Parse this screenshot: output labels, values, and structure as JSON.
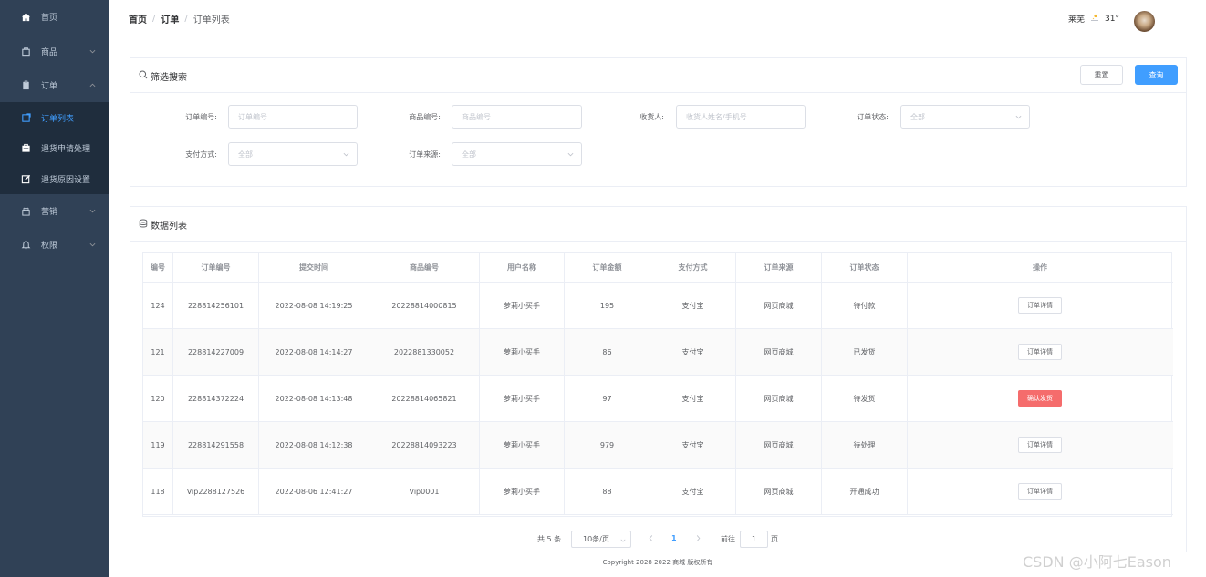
{
  "sidebar": {
    "items": [
      {
        "label": "首页",
        "icon": "home-icon"
      },
      {
        "label": "商品",
        "icon": "bag-icon"
      },
      {
        "label": "订单",
        "icon": "clipboard-icon"
      },
      {
        "label": "营销",
        "icon": "gift-icon"
      },
      {
        "label": "权限",
        "icon": "bell-icon"
      }
    ],
    "order_sub": [
      {
        "label": "订单列表",
        "icon": "list-icon"
      },
      {
        "label": "退货申请处理",
        "icon": "return-icon"
      },
      {
        "label": "退货原因设置",
        "icon": "edit-icon"
      }
    ]
  },
  "header": {
    "breadcrumb": [
      "首页",
      "订单",
      "订单列表"
    ],
    "breadcrumb_sep": "/",
    "city": "莱芜",
    "temperature": "31°"
  },
  "filter": {
    "title": "筛选搜索",
    "reset_label": "重置",
    "query_label": "查询",
    "order_no_label": "订单编号:",
    "order_no_placeholder": "订单编号",
    "product_no_label": "商品编号:",
    "product_no_placeholder": "商品编号",
    "receiver_label": "收货人:",
    "receiver_placeholder": "收货人姓名/手机号",
    "status_label": "订单状态:",
    "status_value": "全部",
    "pay_label": "支付方式:",
    "pay_value": "全部",
    "source_label": "订单来源:",
    "source_value": "全部"
  },
  "table": {
    "title": "数据列表",
    "columns": [
      "编号",
      "订单编号",
      "提交时间",
      "商品编号",
      "用户名称",
      "订单金额",
      "支付方式",
      "订单来源",
      "订单状态",
      "操作"
    ],
    "rows": [
      {
        "id": "124",
        "order_no": "228814256101",
        "time": "2022-08-08 14:19:25",
        "product_no": "20228814000815",
        "user": "萝莉小买手",
        "amount": "195",
        "pay": "支付宝",
        "source": "网页商城",
        "status": "待付款",
        "action": "订单详情",
        "danger": false
      },
      {
        "id": "121",
        "order_no": "228814227009",
        "time": "2022-08-08 14:14:27",
        "product_no": "2022881330052",
        "user": "萝莉小买手",
        "amount": "86",
        "pay": "支付宝",
        "source": "网页商城",
        "status": "已发货",
        "action": "订单详情",
        "danger": false
      },
      {
        "id": "120",
        "order_no": "228814372224",
        "time": "2022-08-08 14:13:48",
        "product_no": "20228814065821",
        "user": "萝莉小买手",
        "amount": "97",
        "pay": "支付宝",
        "source": "网页商城",
        "status": "待发货",
        "action": "确认发货",
        "danger": true
      },
      {
        "id": "119",
        "order_no": "228814291558",
        "time": "2022-08-08 14:12:38",
        "product_no": "20228814093223",
        "user": "萝莉小买手",
        "amount": "979",
        "pay": "支付宝",
        "source": "网页商城",
        "status": "待处理",
        "action": "订单详情",
        "danger": false
      },
      {
        "id": "118",
        "order_no": "Vip2288127526",
        "time": "2022-08-06 12:41:27",
        "product_no": "Vip0001",
        "user": "萝莉小买手",
        "amount": "88",
        "pay": "支付宝",
        "source": "网页商城",
        "status": "开通成功",
        "action": "订单详情",
        "danger": false
      }
    ]
  },
  "pagination": {
    "total": "共 5 条",
    "page_size": "10条/页",
    "current": "1",
    "goto_label": "前往",
    "goto_value": "1",
    "page_unit": "页"
  },
  "footer": {
    "copyright": "Copyright 2028 2022 商城 版权所有"
  },
  "watermark": "CSDN @小阿七Eason",
  "colors": {
    "sidebar_bg": "#304156",
    "submenu_bg": "#1f2d3d",
    "accent": "#409eff",
    "danger": "#f56c6c"
  }
}
